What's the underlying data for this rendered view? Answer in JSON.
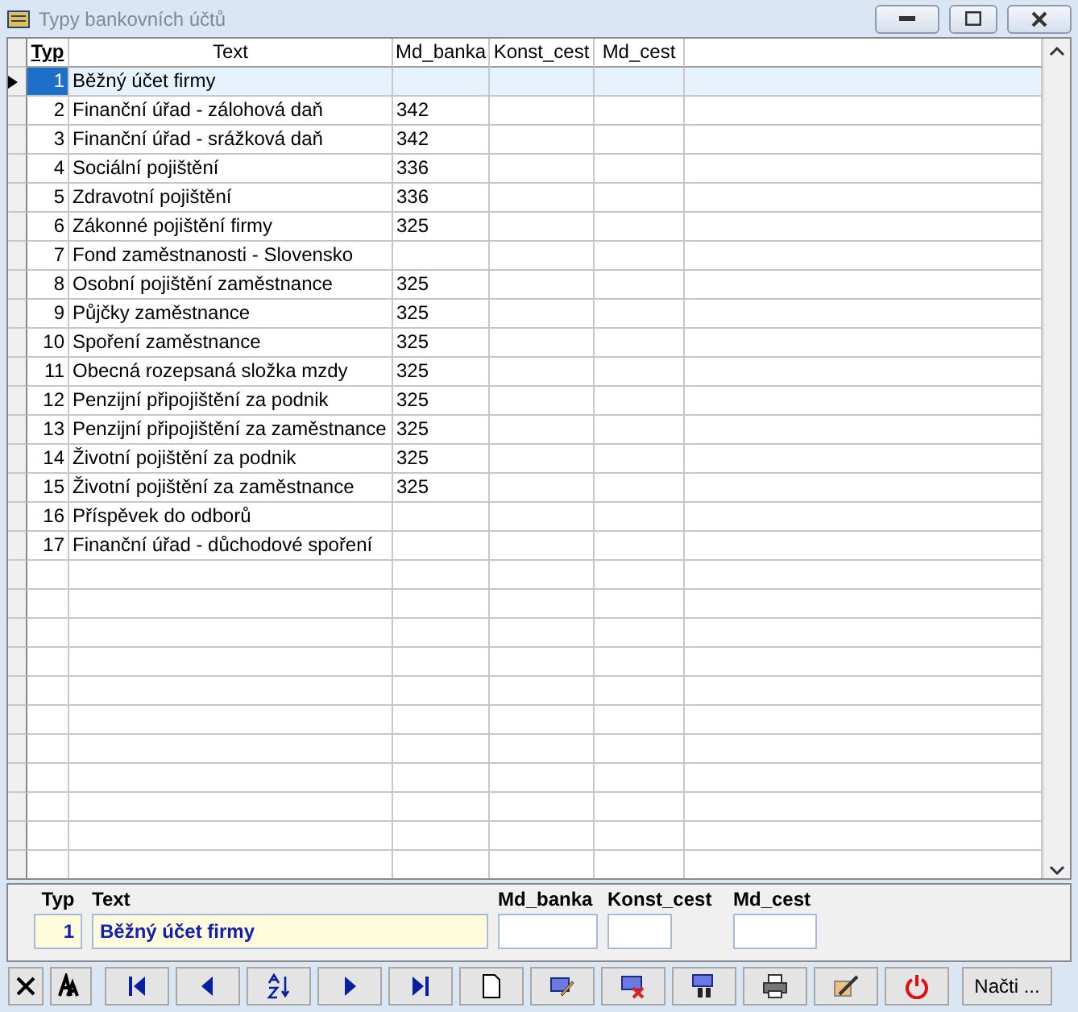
{
  "window": {
    "title": "Typy bankovních účtů"
  },
  "table": {
    "columns": [
      {
        "label": "Typ",
        "sorted": true
      },
      {
        "label": "Text",
        "sorted": false
      },
      {
        "label": "Md_banka",
        "sorted": false
      },
      {
        "label": "Konst_cest",
        "sorted": false
      },
      {
        "label": "Md_cest",
        "sorted": false
      }
    ],
    "rows": [
      {
        "typ": "1",
        "text": "Běžný účet firmy",
        "md_banka": "",
        "selected": true
      },
      {
        "typ": "2",
        "text": "Finanční úřad - zálohová daň",
        "md_banka": "342",
        "selected": false
      },
      {
        "typ": "3",
        "text": "Finanční úřad - srážková daň",
        "md_banka": "342",
        "selected": false
      },
      {
        "typ": "4",
        "text": "Sociální pojištění",
        "md_banka": "336",
        "selected": false
      },
      {
        "typ": "5",
        "text": "Zdravotní pojištění",
        "md_banka": "336",
        "selected": false
      },
      {
        "typ": "6",
        "text": "Zákonné pojištění firmy",
        "md_banka": "325",
        "selected": false
      },
      {
        "typ": "7",
        "text": "Fond zaměstnanosti - Slovensko",
        "md_banka": "",
        "selected": false
      },
      {
        "typ": "8",
        "text": "Osobní pojištění zaměstnance",
        "md_banka": "325",
        "selected": false
      },
      {
        "typ": "9",
        "text": "Půjčky zaměstnance",
        "md_banka": "325",
        "selected": false
      },
      {
        "typ": "10",
        "text": "Spoření zaměstnance",
        "md_banka": "325",
        "selected": false
      },
      {
        "typ": "11",
        "text": "Obecná rozepsaná složka mzdy",
        "md_banka": "325",
        "selected": false
      },
      {
        "typ": "12",
        "text": "Penzijní připojištění za podnik",
        "md_banka": "325",
        "selected": false
      },
      {
        "typ": "13",
        "text": "Penzijní připojištění za zaměstnance",
        "md_banka": "325",
        "selected": false
      },
      {
        "typ": "14",
        "text": "Životní pojištění za podnik",
        "md_banka": "325",
        "selected": false
      },
      {
        "typ": "15",
        "text": "Životní pojištění za zaměstnance",
        "md_banka": "325",
        "selected": false
      },
      {
        "typ": "16",
        "text": "Příspěvek do odborů",
        "md_banka": "",
        "selected": false
      },
      {
        "typ": "17",
        "text": "Finanční úřad - důchodové spoření",
        "md_banka": "",
        "selected": false
      }
    ]
  },
  "form": {
    "typ_label": "Typ",
    "typ_value": "1",
    "text_label": "Text",
    "text_value": "Běžný účet firmy",
    "md_banka_label": "Md_banka",
    "konst_cest_label": "Konst_cest",
    "md_cest_label": "Md_cest"
  },
  "toolbar": [
    {
      "kind": "cancel"
    },
    {
      "kind": "font"
    },
    {
      "kind": "first"
    },
    {
      "kind": "prev"
    },
    {
      "kind": "sort"
    },
    {
      "kind": "next"
    },
    {
      "kind": "last"
    },
    {
      "kind": "new"
    },
    {
      "kind": "edit"
    },
    {
      "kind": "delete"
    },
    {
      "kind": "find"
    },
    {
      "kind": "print"
    },
    {
      "kind": "tools"
    },
    {
      "kind": "power"
    },
    {
      "kind": "text",
      "label": "Načti ..."
    }
  ]
}
